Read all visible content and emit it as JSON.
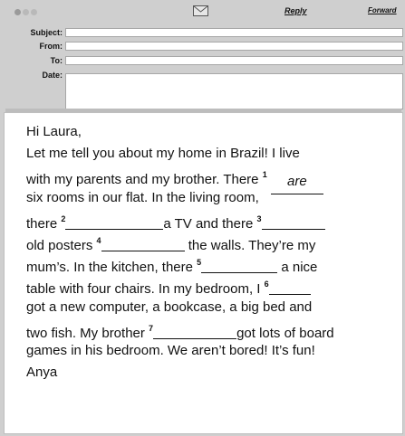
{
  "toolbar": {
    "envelope_icon": "envelope-icon",
    "reply_label": "Reply",
    "forward_label": "Forward"
  },
  "fields": {
    "subject_label": "Subject:",
    "from_label": "From:",
    "to_label": "To:",
    "date_label": "Date:"
  },
  "letter": {
    "greeting": "Hi Laura,",
    "l2": "Let me tell you about my home in Brazil! I live",
    "l3a": "with my parents and my brother. There ",
    "n1": "1",
    "answer1": "are",
    "l4": "six rooms in our flat. In the living room,",
    "l5a": "there ",
    "n2": "2",
    "l5b": "a TV and there ",
    "n3": "3",
    "l6a": "old posters ",
    "n4": "4",
    "l6b": " the walls. They’re my",
    "l7a": "mum’s. In the kitchen, there ",
    "n5": "5",
    "l7b": " a nice",
    "l8a": "table with four chairs. In my bedroom, I ",
    "n6": "6",
    "l9": "got a new computer, a bookcase, a big bed and",
    "l10a": "two fish. My brother ",
    "n7": "7",
    "l10b": "got lots of board",
    "l11": "games in his bedroom. We aren’t bored! It’s fun!",
    "signature": "Anya"
  }
}
